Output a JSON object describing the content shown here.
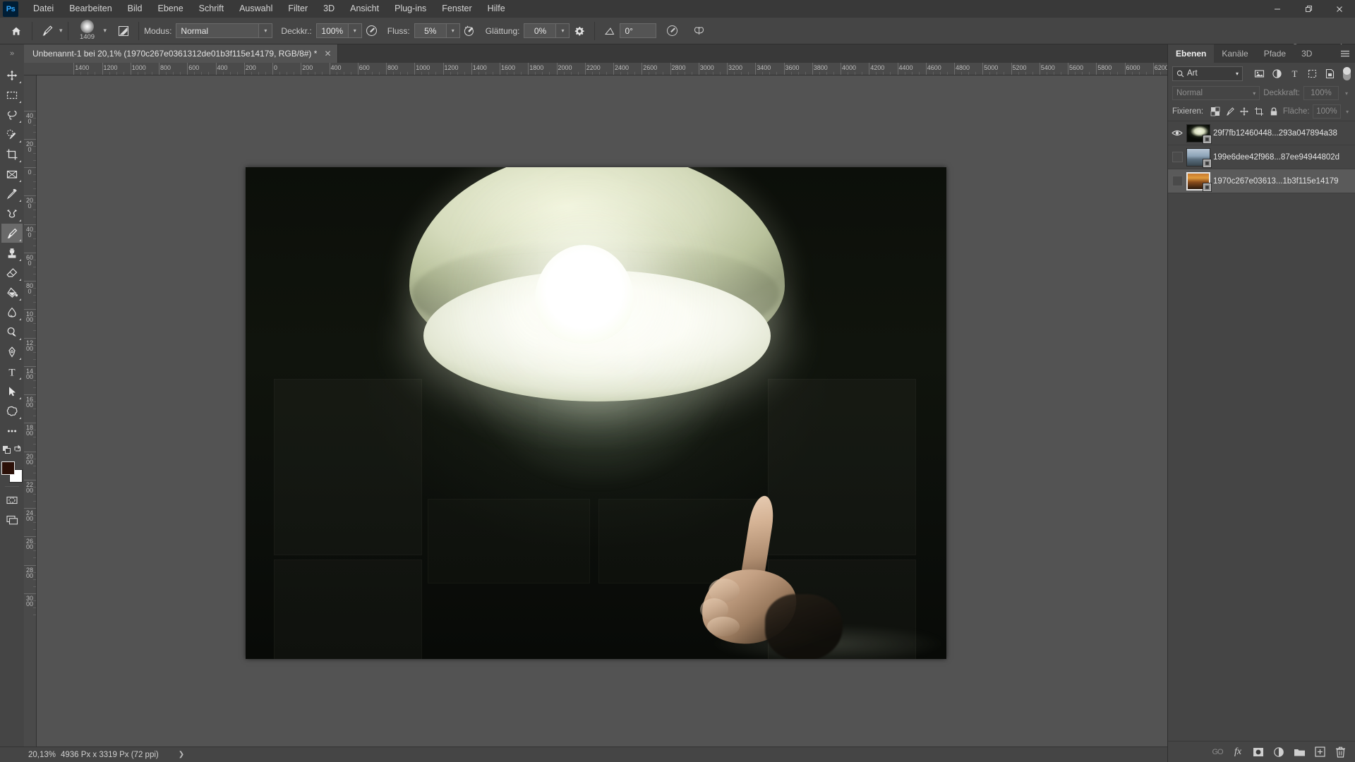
{
  "app": {
    "name": "Adobe Photoshop",
    "logo_text": "Ps",
    "accent_color": "#31a8ff",
    "chrome_bg": "#393939",
    "panel_bg": "#454545",
    "canvas_bg": "#535353"
  },
  "menubar": {
    "items": [
      {
        "label": "Datei"
      },
      {
        "label": "Bearbeiten"
      },
      {
        "label": "Bild"
      },
      {
        "label": "Ebene"
      },
      {
        "label": "Schrift"
      },
      {
        "label": "Auswahl"
      },
      {
        "label": "Filter"
      },
      {
        "label": "3D"
      },
      {
        "label": "Ansicht"
      },
      {
        "label": "Plug-ins"
      },
      {
        "label": "Fenster"
      },
      {
        "label": "Hilfe"
      }
    ],
    "window_controls": {
      "minimize": "—",
      "maximize": "❐",
      "close": "✕"
    }
  },
  "optionsbar": {
    "home_icon": "home-icon",
    "tool_icon": "brush-tool-icon",
    "brush_size": "1409",
    "brush_settings_icon": "brush-settings-panel-icon",
    "mode_label": "Modus:",
    "mode_value": "Normal",
    "opacity_label": "Deckkr.:",
    "opacity_value": "100%",
    "opacity_pressure_icon": "pressure-opacity-icon",
    "flow_label": "Fluss:",
    "flow_value": "5%",
    "airbrush_icon": "airbrush-icon",
    "smoothing_label": "Glättung:",
    "smoothing_value": "0%",
    "smoothing_gear_icon": "gear-icon",
    "angle_icon": "angle-icon",
    "angle_value": "0°",
    "pressure_size_icon": "pressure-size-icon",
    "symmetry_icon": "symmetry-butterfly-icon",
    "right_icons": [
      {
        "name": "share-account-icon"
      },
      {
        "name": "search-icon"
      },
      {
        "name": "workspace-icon"
      },
      {
        "name": "chevron-down-icon"
      },
      {
        "name": "share-export-icon"
      }
    ]
  },
  "tabbar": {
    "expander_icon": "panel-expand-icon",
    "document": {
      "title": "Unbenannt-1 bei 20,1% (1970c267e0361312de01b3f115e14179, RGB/8#) *",
      "close_icon": "close-icon"
    }
  },
  "toolbar": {
    "tools": [
      {
        "name": "move-tool",
        "icon": "move-icon",
        "active": false
      },
      {
        "name": "rectangular-marquee-tool",
        "icon": "marquee-icon",
        "active": false
      },
      {
        "name": "lasso-tool",
        "icon": "lasso-icon",
        "active": false
      },
      {
        "name": "object-selection-tool",
        "icon": "quick-selection-icon",
        "active": false
      },
      {
        "name": "crop-tool",
        "icon": "crop-icon",
        "active": false
      },
      {
        "name": "frame-tool",
        "icon": "frame-icon",
        "active": false
      },
      {
        "name": "eyedropper-tool",
        "icon": "eyedropper-icon",
        "active": false
      },
      {
        "name": "healing-brush-tool",
        "icon": "healing-brush-icon",
        "active": false
      },
      {
        "name": "brush-tool",
        "icon": "brush-icon",
        "active": true
      },
      {
        "name": "clone-stamp-tool",
        "icon": "stamp-icon",
        "active": false
      },
      {
        "name": "eraser-tool",
        "icon": "eraser-icon",
        "active": false
      },
      {
        "name": "gradient-tool",
        "icon": "paint-bucket-icon",
        "active": false
      },
      {
        "name": "blur-tool",
        "icon": "blur-drop-icon",
        "active": false
      },
      {
        "name": "dodge-tool",
        "icon": "dodge-icon",
        "active": false
      },
      {
        "name": "pen-tool",
        "icon": "pen-icon",
        "active": false
      },
      {
        "name": "type-tool",
        "icon": "type-T-icon",
        "active": false
      },
      {
        "name": "path-selection-tool",
        "icon": "path-arrow-icon",
        "active": false
      },
      {
        "name": "custom-shape-tool",
        "icon": "shape-icon",
        "active": false
      },
      {
        "name": "edit-toolbar-tool",
        "icon": "ellipsis-icon",
        "active": false
      }
    ],
    "screen_mode_icons": [
      {
        "name": "default-colors-icon"
      },
      {
        "name": "swap-colors-icon"
      }
    ],
    "foreground_color": "#2b1008",
    "background_color": "#ffffff",
    "quick_mask_icon": "quick-mask-icon",
    "screen_mode_icon": "screen-mode-icon"
  },
  "rulers": {
    "unit": "px",
    "horizontal_labels": [
      "1400",
      "1200",
      "1000",
      "800",
      "600",
      "400",
      "200",
      "0",
      "200",
      "400",
      "600",
      "800",
      "1000",
      "1200",
      "1400",
      "1600",
      "1800",
      "2000",
      "2200",
      "2400",
      "2600",
      "2800",
      "3000",
      "3200",
      "3400",
      "3600",
      "3800",
      "4000",
      "4200",
      "4400",
      "4600",
      "4800",
      "5000",
      "5200",
      "5400",
      "5600",
      "5800",
      "6000",
      "6200"
    ],
    "vertical_labels": [
      "400",
      "200",
      "0",
      "200",
      "400",
      "600",
      "800",
      "1000",
      "1200",
      "1400",
      "1600",
      "1800",
      "2000",
      "2200",
      "2400",
      "2600",
      "2800",
      "3000"
    ]
  },
  "canvas": {
    "image_description": "Photo of a glowing pale-green ceiling dome lamp in a dark room with a hand reaching up from the lower right",
    "colors": {
      "background_dark": "#0c0f0a",
      "shade_green": "#d5dbbc",
      "shade_highlight": "#f2f4dd",
      "diffuser_white": "#ffffff",
      "skin": "#d5b395"
    }
  },
  "right_panel": {
    "tabs": [
      {
        "label": "Ebenen",
        "active": true
      },
      {
        "label": "Kanäle",
        "active": false
      },
      {
        "label": "Pfade",
        "active": false
      },
      {
        "label": "3D",
        "active": false
      }
    ],
    "menu_icon": "panel-menu-icon",
    "filter": {
      "search_icon": "search-icon",
      "kind_value": "Art",
      "chevron_icon": "chevron-down-icon",
      "icons": [
        {
          "name": "filter-pixel-icon"
        },
        {
          "name": "filter-adjustment-icon"
        },
        {
          "name": "filter-type-icon"
        },
        {
          "name": "filter-shape-icon"
        },
        {
          "name": "filter-smart-object-icon"
        }
      ],
      "toggle_name": "filter-enable-toggle"
    },
    "blend": {
      "mode_value": "Normal",
      "opacity_label": "Deckkraft:",
      "opacity_value": "100%"
    },
    "lock": {
      "label": "Fixieren:",
      "icons": [
        {
          "name": "lock-transparency-icon"
        },
        {
          "name": "lock-image-icon"
        },
        {
          "name": "lock-position-icon"
        },
        {
          "name": "lock-artboard-icon"
        },
        {
          "name": "lock-all-icon"
        }
      ],
      "fill_label": "Fläche:",
      "fill_value": "100%"
    },
    "layers": [
      {
        "name": "29f7fb12460448...293a047894a38",
        "visible": true,
        "selected": false,
        "smart_object": true,
        "thumb_type": "night-lamp"
      },
      {
        "name": "199e6dee42f968...87ee94944802d",
        "visible": false,
        "selected": false,
        "smart_object": true,
        "thumb_type": "mountain"
      },
      {
        "name": "1970c267e03613...1b3f115e14179",
        "visible": false,
        "selected": true,
        "smart_object": true,
        "thumb_type": "sunset"
      }
    ],
    "footer_icons": [
      {
        "name": "link-layers-icon",
        "label": "GO"
      },
      {
        "name": "layer-style-fx-icon",
        "label": "fx"
      },
      {
        "name": "layer-mask-icon"
      },
      {
        "name": "adjustment-layer-icon"
      },
      {
        "name": "new-group-icon"
      },
      {
        "name": "new-layer-icon"
      },
      {
        "name": "delete-layer-icon"
      }
    ]
  },
  "statusbar": {
    "zoom": "20,13%",
    "dimensions": "4936 Px x 3319 Px (72 ppi)",
    "arrow_icon": "chevron-right-icon"
  }
}
